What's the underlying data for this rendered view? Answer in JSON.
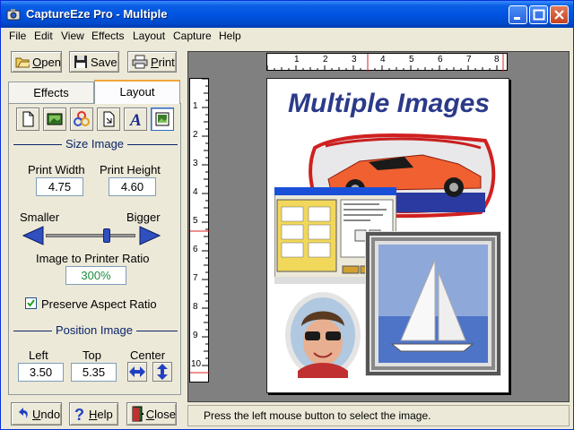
{
  "window": {
    "title": "CaptureEze Pro - Multiple"
  },
  "menu": [
    "File",
    "Edit",
    "View",
    "Effects",
    "Layout",
    "Capture",
    "Help"
  ],
  "toolbar": {
    "open_mnemonic": "O",
    "open_rest": "pen",
    "save_label": "Save",
    "print_mnemonic": "P",
    "print_rest": "rint"
  },
  "tabs": {
    "effects": "Effects",
    "layout": "Layout"
  },
  "size_image": {
    "heading": "Size Image",
    "print_width_label": "Print Width",
    "print_height_label": "Print Height",
    "print_width": "4.75",
    "print_height": "4.60",
    "smaller_label": "Smaller",
    "bigger_label": "Bigger",
    "slider_level": 0.68,
    "ratio_label": "Image to Printer Ratio",
    "ratio_value": "300%",
    "preserve_label": "Preserve Aspect Ratio",
    "preserve_checked": true
  },
  "position_image": {
    "heading": "Position Image",
    "left_label": "Left",
    "top_label": "Top",
    "center_label": "Center",
    "left_value": "3.50",
    "top_value": "5.35"
  },
  "bottom_buttons": {
    "undo_mnemonic": "U",
    "undo_rest": "ndo",
    "help_mnemonic": "H",
    "help_rest": "elp",
    "close_mnemonic": "C",
    "close_rest": "lose"
  },
  "ruler": {
    "h_ticks": [
      "1",
      "2",
      "3",
      "4",
      "5",
      "6",
      "7",
      "8"
    ],
    "v_ticks": [
      "1",
      "2",
      "3",
      "4",
      "5",
      "6",
      "7",
      "8",
      "9",
      "10"
    ]
  },
  "page": {
    "title": "Multiple Images"
  },
  "status": {
    "text": "Press the left mouse button to select the image."
  },
  "colors": {
    "title_blue": "#0054E3",
    "page_title": "#2B3A8A",
    "accent": "#316AC5"
  }
}
